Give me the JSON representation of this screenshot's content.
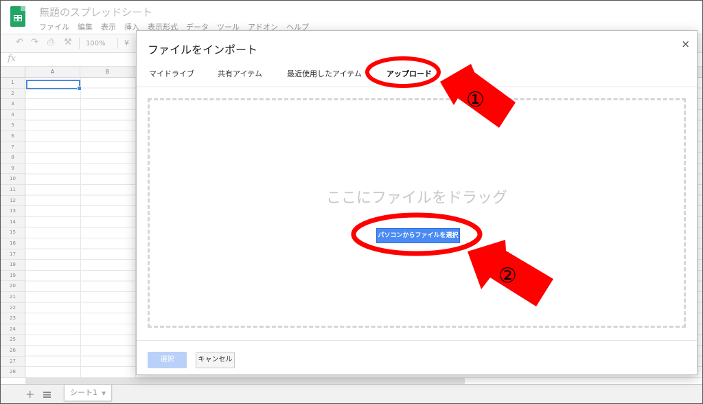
{
  "app": {
    "doc_title": "無題のスプレッドシート",
    "menu": [
      "ファイル",
      "編集",
      "表示",
      "挿入",
      "表示形式",
      "データ",
      "ツール",
      "アドオン",
      "ヘルプ"
    ]
  },
  "toolbar": {
    "zoom": "100%",
    "currency": "¥",
    "fx": "fx"
  },
  "grid": {
    "columns": [
      "A",
      "B"
    ],
    "rows": [
      "1",
      "2",
      "3",
      "4",
      "5",
      "6",
      "7",
      "8",
      "9",
      "10",
      "11",
      "12",
      "13",
      "14",
      "15",
      "16",
      "17",
      "18",
      "19",
      "20",
      "21",
      "22",
      "23",
      "24",
      "25",
      "26",
      "27",
      "28"
    ]
  },
  "sheets": {
    "active_tab": "シート1"
  },
  "dialog": {
    "title": "ファイルをインポート",
    "close": "×",
    "tabs": [
      {
        "label": "マイドライブ"
      },
      {
        "label": "共有アイテム"
      },
      {
        "label": "最近使用したアイテム"
      },
      {
        "label": "アップロード"
      }
    ],
    "drop_text": "ここにファイルをドラッグ",
    "pick_button": "パソコンからファイルを選択",
    "select_button": "選択",
    "cancel_button": "キャンセル"
  },
  "annotations": {
    "color": "#ff0000",
    "marker_1": "①",
    "marker_2": "②"
  },
  "colors": {
    "sheets_green": "#23a566",
    "primary_blue": "#4a8af4",
    "disabled_blue": "#b9d1f8"
  }
}
